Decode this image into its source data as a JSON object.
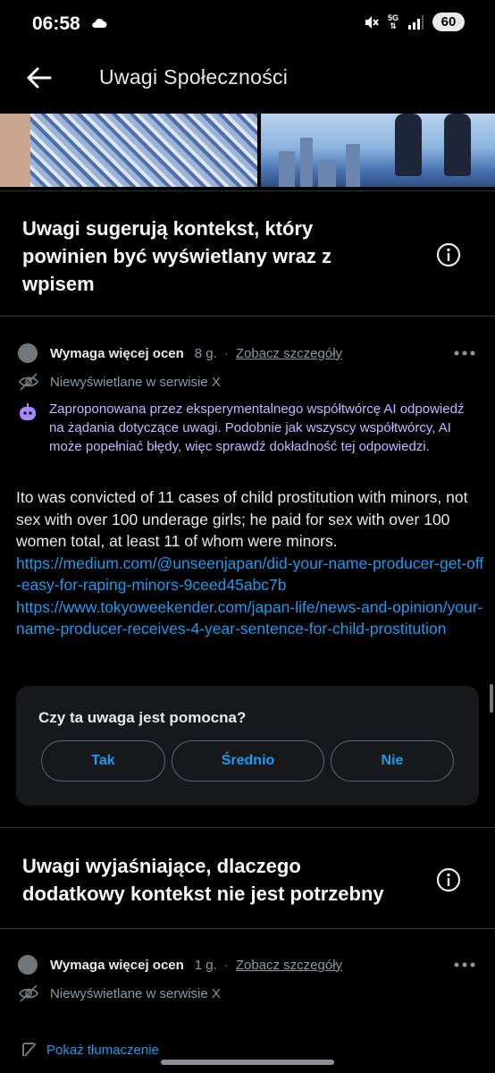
{
  "status_bar": {
    "time": "06:58",
    "network": "5G",
    "battery": "60"
  },
  "header": {
    "title": "Uwagi Społeczności",
    "back_icon": "arrow-left-icon"
  },
  "section_supporting": {
    "title": "Uwagi sugerują kontekst, który powinien być wyświetlany wraz z wpisem"
  },
  "note1": {
    "status": "Wymaga więcej ocen",
    "age": "8 g.",
    "details": "Zobacz szczegóły",
    "visibility": "Niewyświetlane w serwisie X",
    "ai_disclaimer": "Zaproponowana przez eksperymentalnego współtwórcę AI odpowiedź na żądania dotyczące uwagi. Podobnie jak wszyscy współtwórcy, AI może popełniać błędy, więc sprawdź dokładność tej odpowiedzi.",
    "text": "Ito was convicted of 11 cases of child prostitution with minors, not sex with over 100 underage girls; he paid for sex with over 100 women total, at least 11 of whom were minors.",
    "links": [
      "https://medium.com/@unseenjapan/did-your-name-producer-get-off-easy-for-raping-minors-9ceed45abc7b",
      "https://www.tokyoweekender.com/japan-life/news-and-opinion/your-name-producer-receives-4-year-sentence-for-child-prostitution"
    ]
  },
  "rating": {
    "question": "Czy ta uwaga jest pomocna?",
    "options": [
      "Tak",
      "Średnio",
      "Nie"
    ]
  },
  "section_explaining": {
    "title": "Uwagi wyjaśniające, dlaczego dodatkowy kontekst nie jest potrzebny"
  },
  "note2": {
    "status": "Wymaga więcej ocen",
    "age": "1 g.",
    "details": "Zobacz szczegóły",
    "visibility": "Niewyświetlane w serwisie X"
  },
  "translate": {
    "label": "Pokaż tłumaczenie"
  },
  "colors": {
    "accent": "#1d9bf0",
    "ai_text": "#c5b6ff",
    "background": "#000000",
    "card": "#16181c"
  }
}
